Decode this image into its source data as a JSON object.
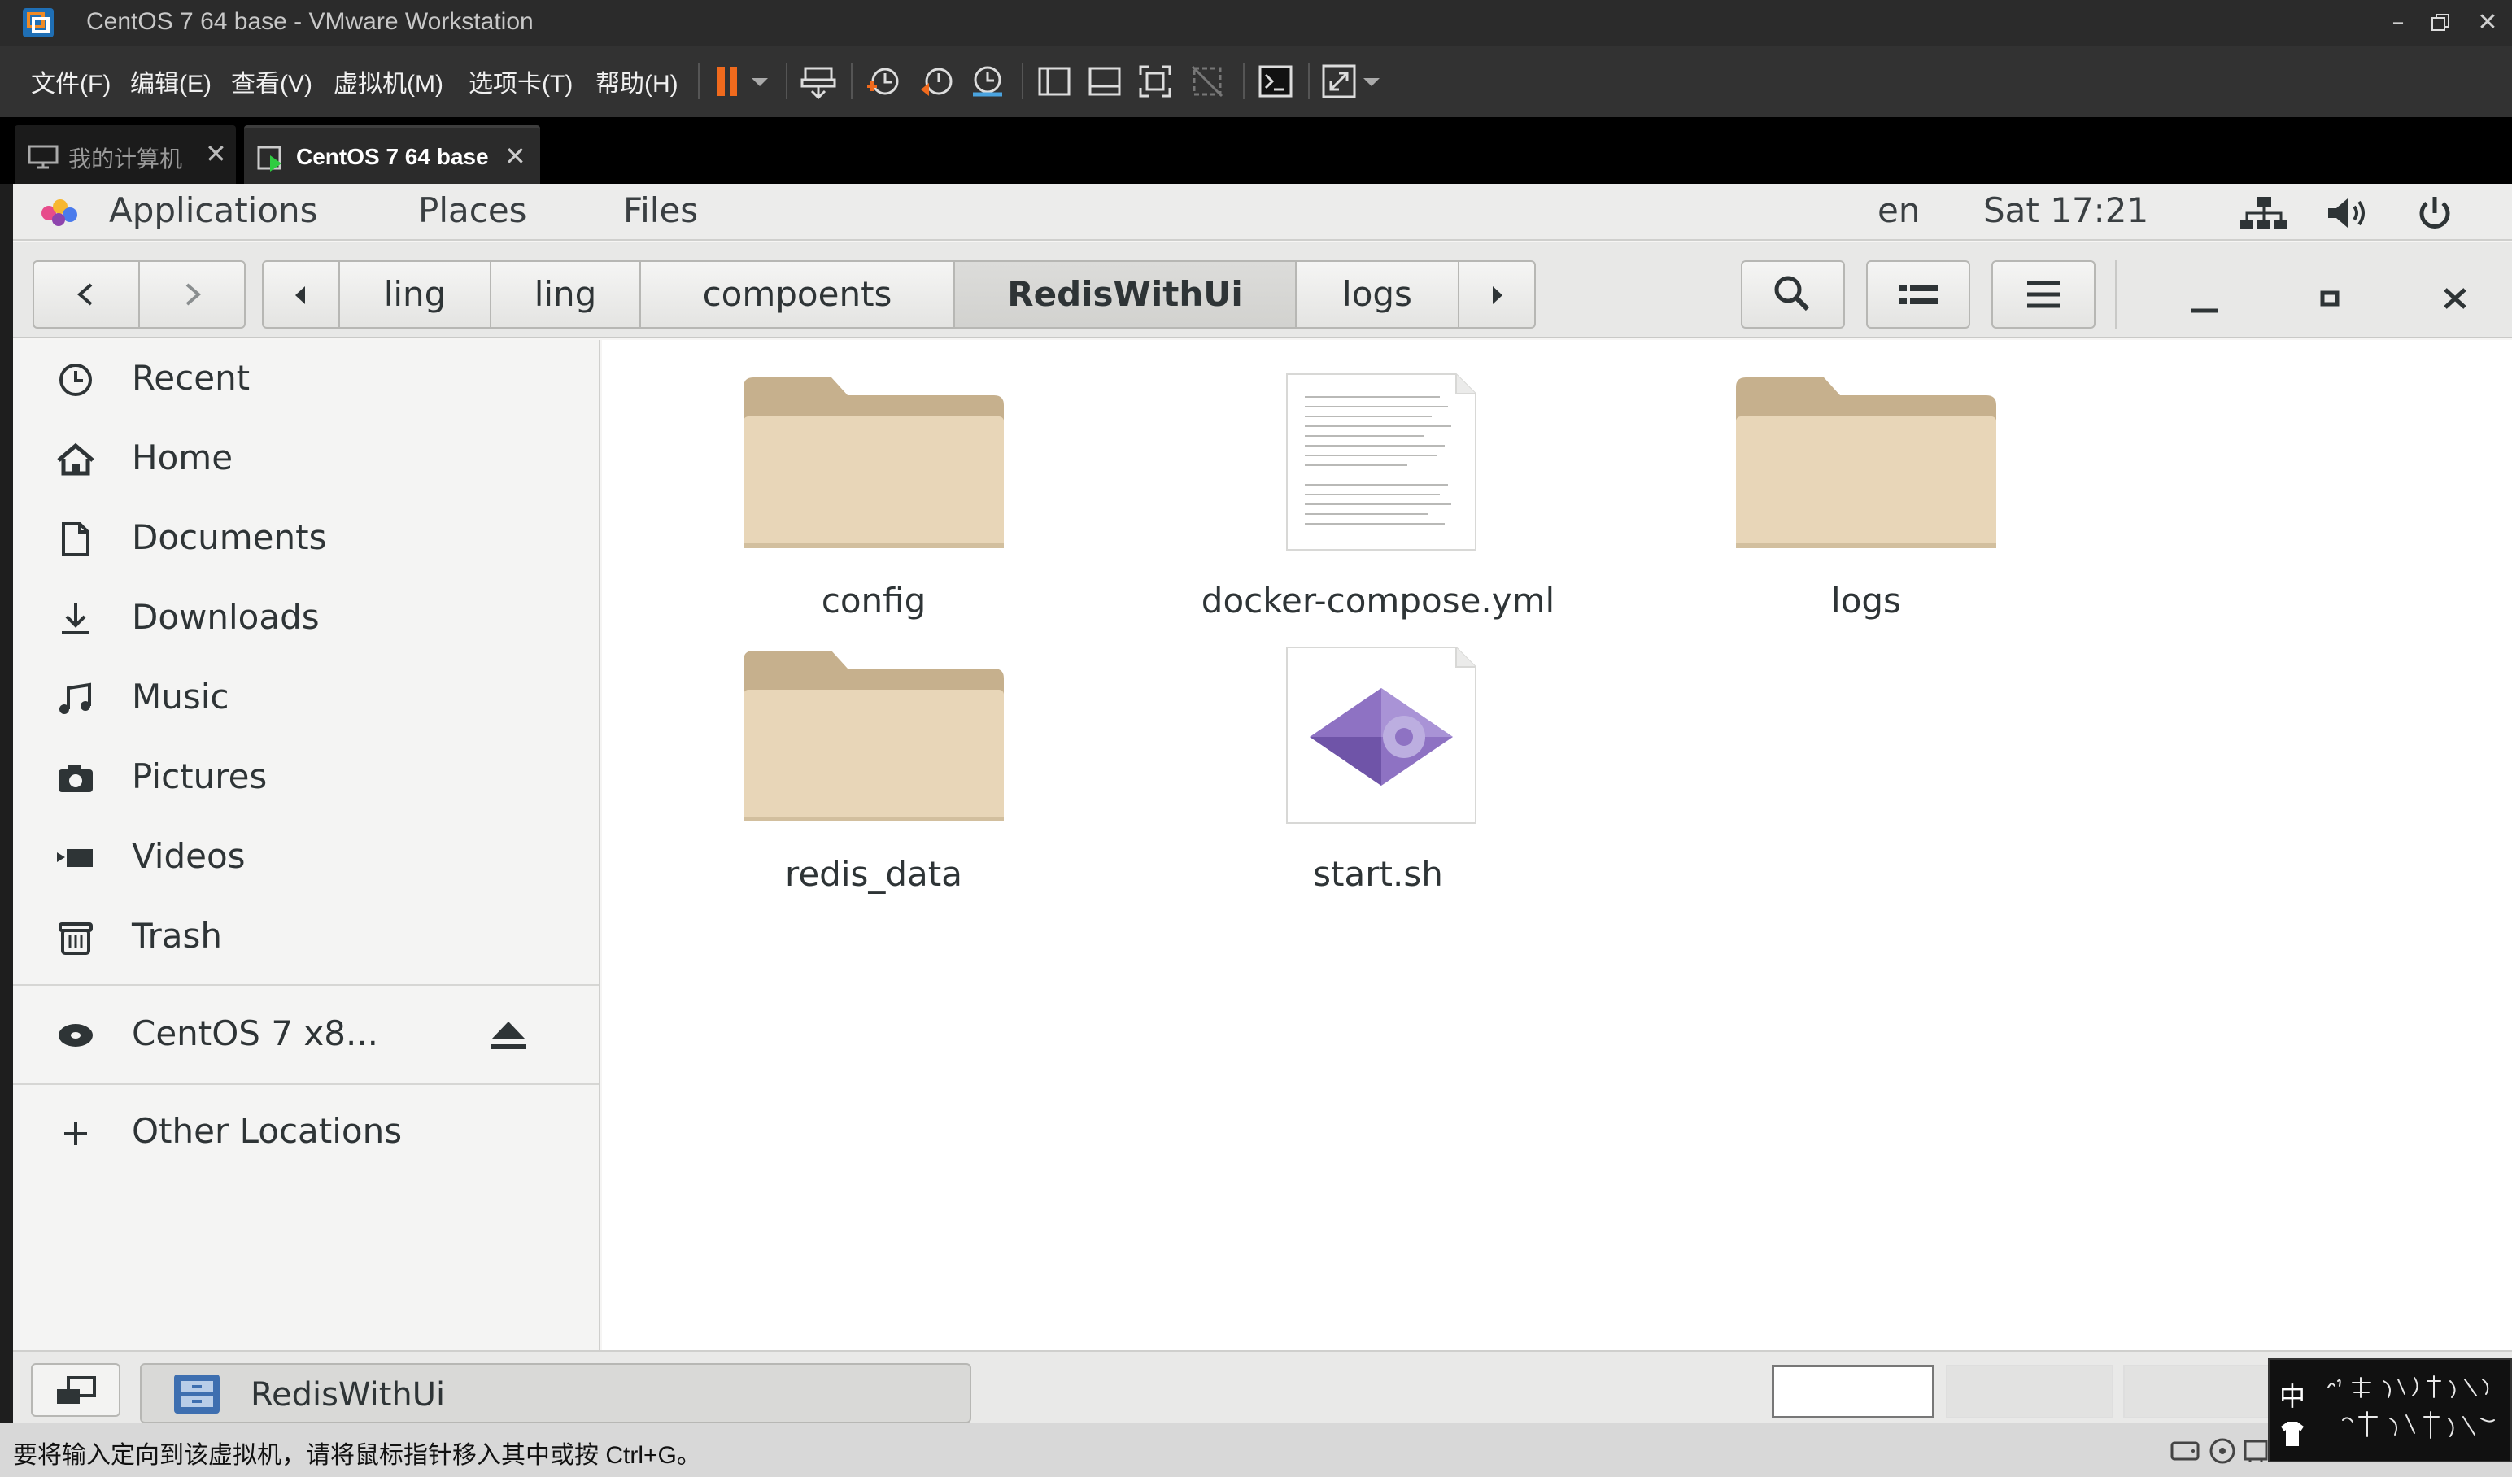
{
  "window": {
    "title": "CentOS 7 64 base - VMware Workstation"
  },
  "menu": {
    "items": [
      "文件(F)",
      "编辑(E)",
      "查看(V)",
      "虚拟机(M)",
      "选项卡(T)",
      "帮助(H)"
    ]
  },
  "tabs": [
    {
      "label": "我的计算机",
      "active": false
    },
    {
      "label": "CentOS 7 64 base",
      "active": true
    }
  ],
  "gnome": {
    "applications": "Applications",
    "places": "Places",
    "files": "Files",
    "lang": "en",
    "clock": "Sat 17:21"
  },
  "path": {
    "segments": [
      "ling",
      "ling",
      "compoents",
      "RedisWithUi",
      "logs"
    ],
    "active": "RedisWithUi"
  },
  "sidebar": {
    "items": [
      "Recent",
      "Home",
      "Documents",
      "Downloads",
      "Music",
      "Pictures",
      "Videos",
      "Trash"
    ],
    "device": "CentOS 7 x8...",
    "other": "Other Locations"
  },
  "files": [
    {
      "name": "config",
      "kind": "folder"
    },
    {
      "name": "docker-compose.yml",
      "kind": "text"
    },
    {
      "name": "logs",
      "kind": "folder"
    },
    {
      "name": "redis_data",
      "kind": "folder"
    },
    {
      "name": "start.sh",
      "kind": "script"
    }
  ],
  "taskbar": {
    "window_label": "RedisWithUi"
  },
  "status": {
    "hint": "要将输入定向到该虚拟机，请将鼠标指针移入其中或按 Ctrl+G。"
  },
  "ime": {
    "mode": "中"
  },
  "colors": {
    "folder": "#e8d6b8",
    "folder_tab": "#c6b08d",
    "accent_orange": "#f06a1d"
  }
}
